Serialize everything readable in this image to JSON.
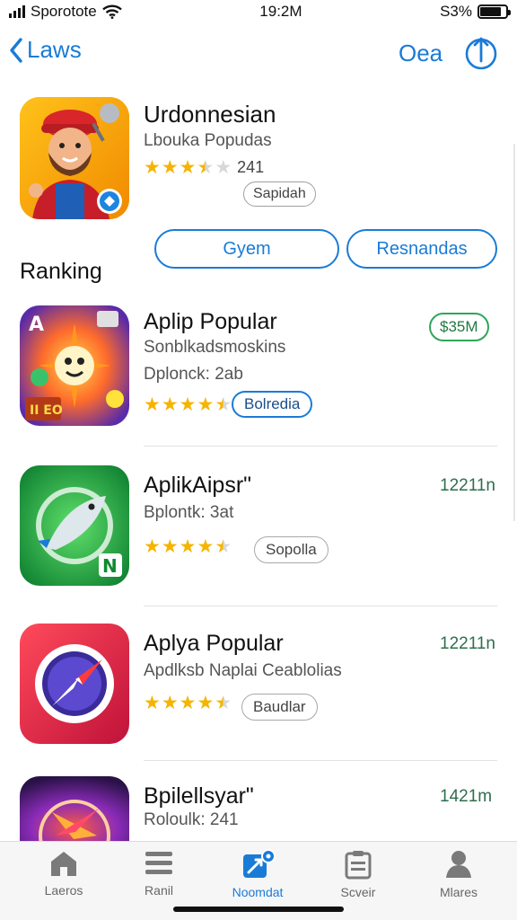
{
  "status_bar": {
    "carrier": "Sporotote",
    "time": "19:2M",
    "battery": "S3%",
    "battery_level": 0.83
  },
  "nav": {
    "back_label": "Laws",
    "action_label": "Oea",
    "share_icon": "share-icon"
  },
  "featured": {
    "title": "Urdonnesian",
    "subtitle": "Lbouka Popudas",
    "rating_count": "241",
    "rating": 3.5,
    "chip_label": "Sapidah"
  },
  "buttons": {
    "left": "Gyem",
    "right": "Resnandas"
  },
  "section_title": "Ranking",
  "apps": [
    {
      "title": "Aplip Popular",
      "subtitle": "Sonblkadsmoskins",
      "meta": "Dplonck: 2ab",
      "rating": 4.5,
      "chip": "Bolredia",
      "price": "$35M"
    },
    {
      "title": "AplikAipsr\"",
      "meta": "Bplontk: 3at",
      "rating": 4.5,
      "chip": "Sopolla",
      "size": "12211n"
    },
    {
      "title": "Aplya Popular",
      "subtitle": "Apdlksb Naplai Ceablolias",
      "rating": 4.5,
      "chip": "Baudlar",
      "size": "12211n"
    },
    {
      "title": "Bpilellsyar\"",
      "meta": "Roloulk: 241",
      "size": "1421m"
    }
  ],
  "tabs": [
    {
      "label": "Laeros",
      "icon": "home-icon",
      "active": false
    },
    {
      "label": "Ranil",
      "icon": "list-icon",
      "active": false
    },
    {
      "label": "Noomdat",
      "icon": "rocket-icon",
      "active": true
    },
    {
      "label": "Scveir",
      "icon": "clipboard-icon",
      "active": false
    },
    {
      "label": "Mlares",
      "icon": "person-icon",
      "active": false
    }
  ],
  "colors": {
    "accent": "#1a7bd6",
    "price_green": "#2ea65a",
    "star": "#f5b400"
  }
}
